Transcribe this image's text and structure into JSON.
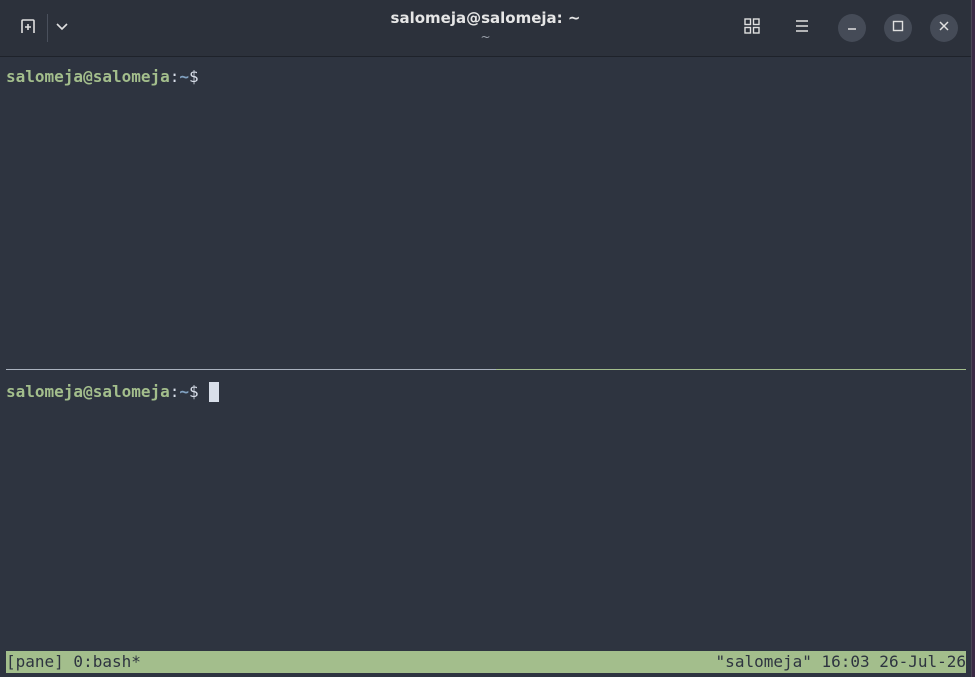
{
  "window": {
    "title": "salomeja@salomeja: ~",
    "subtitle": "~"
  },
  "titlebar": {
    "new_tab_icon": "new-tab-icon",
    "dropdown_icon": "chevron-down-icon",
    "grid_icon": "grid-icon",
    "menu_icon": "hamburger-menu-icon",
    "minimize_icon": "minimize-icon",
    "maximize_icon": "maximize-icon",
    "close_icon": "close-icon"
  },
  "panes": [
    {
      "prompt_user": "salomeja@salomeja",
      "prompt_colon": ":",
      "prompt_path": "~",
      "prompt_symbol": "$"
    },
    {
      "prompt_user": "salomeja@salomeja",
      "prompt_colon": ":",
      "prompt_path": "~",
      "prompt_symbol": "$"
    }
  ],
  "statusbar": {
    "left": "[pane] 0:bash*",
    "right": "\"salomeja\" 16:03 26-Jul-26"
  },
  "colors": {
    "background": "#2e3440",
    "prompt_user": "#a3be8c",
    "prompt_path": "#81a1c1",
    "statusbar": "#a3be8c"
  }
}
